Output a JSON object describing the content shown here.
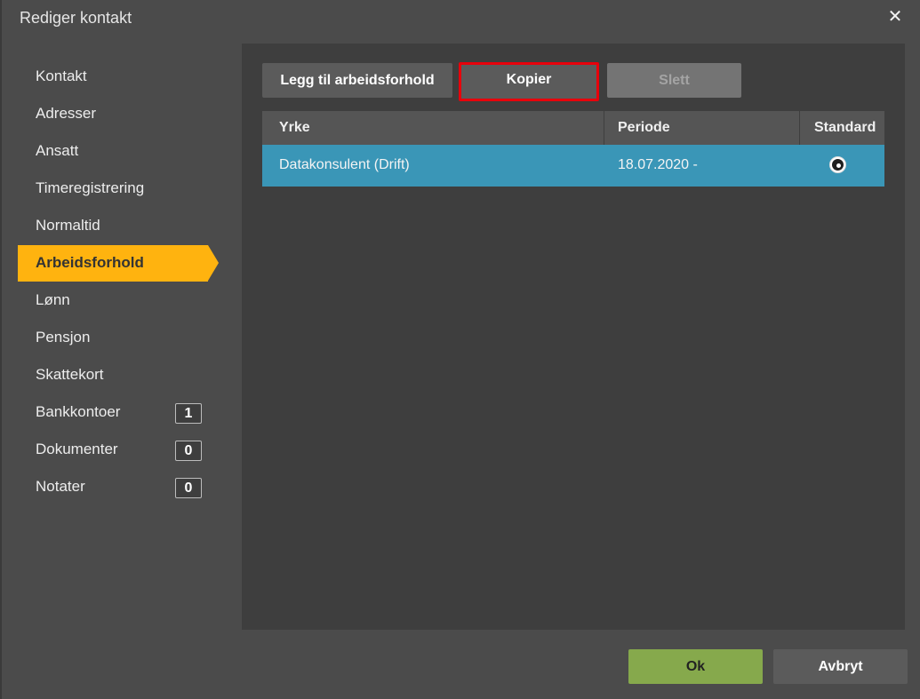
{
  "window": {
    "title": "Rediger kontakt",
    "close_icon": "close-icon"
  },
  "sidebar": {
    "items": [
      {
        "label": "Kontakt"
      },
      {
        "label": "Adresser"
      },
      {
        "label": "Ansatt"
      },
      {
        "label": "Timeregistrering"
      },
      {
        "label": "Normaltid"
      },
      {
        "label": "Arbeidsforhold",
        "active": true
      },
      {
        "label": "Lønn"
      },
      {
        "label": "Pensjon"
      },
      {
        "label": "Skattekort"
      },
      {
        "label": "Bankkontoer",
        "badge": "1"
      },
      {
        "label": "Dokumenter",
        "badge": "0"
      },
      {
        "label": "Notater",
        "badge": "0"
      }
    ]
  },
  "toolbar": {
    "add_label": "Legg til arbeidsforhold",
    "copy_label": "Kopier",
    "delete_label": "Slett"
  },
  "grid": {
    "columns": [
      "Yrke",
      "Periode",
      "Standard"
    ],
    "rows": [
      {
        "yrke": "Datakonsulent (Drift)",
        "periode": "18.07.2020 -",
        "standard": true
      }
    ]
  },
  "footer": {
    "ok_label": "Ok",
    "cancel_label": "Avbryt"
  },
  "colors": {
    "accent": "#ffb30f",
    "selected_row": "#3a96b7",
    "ok_button": "#86a94c",
    "highlight_border": "#e8000b"
  }
}
